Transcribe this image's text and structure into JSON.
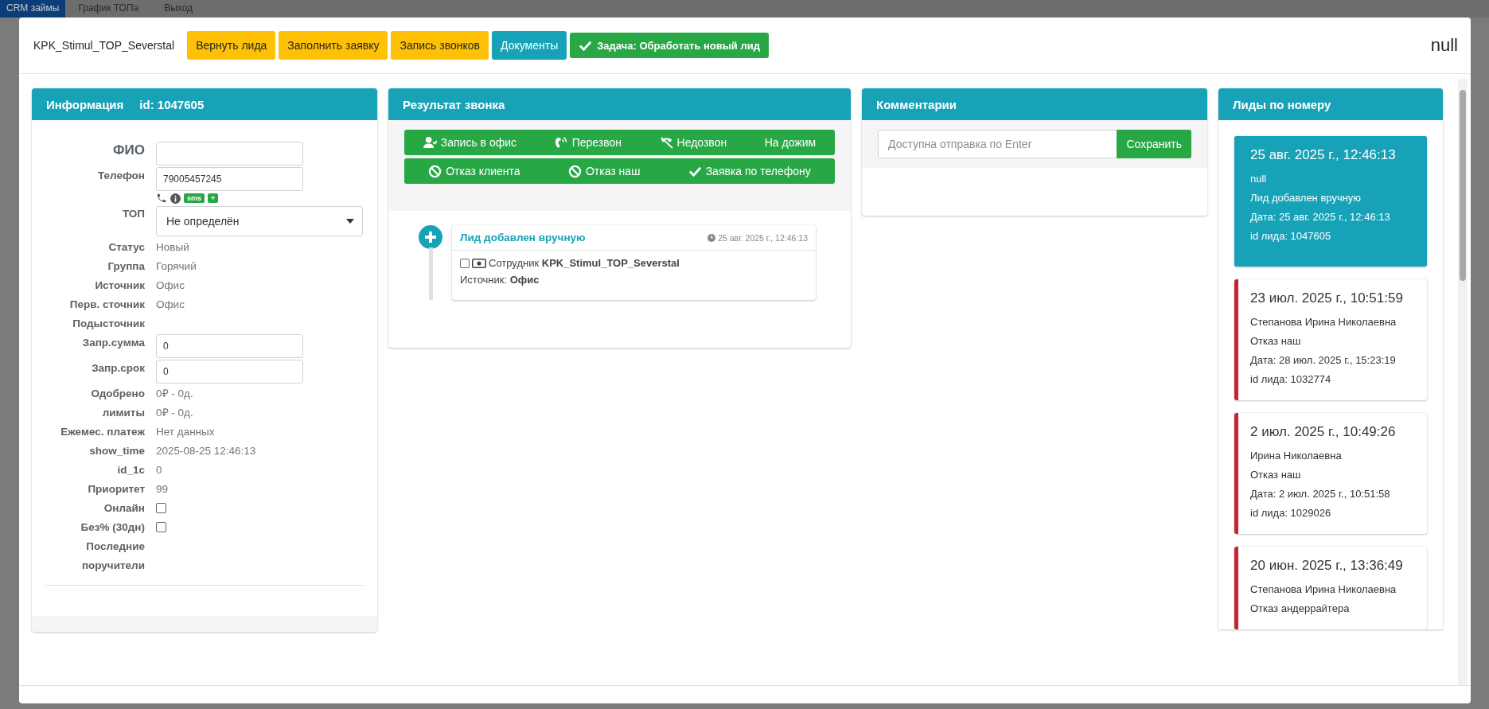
{
  "background_nav": {
    "brand": "CRM займы",
    "links": [
      "График ТОПа",
      "Выход"
    ]
  },
  "modal": {
    "title": "KPK_Stimul_TOP_Severstal",
    "right_text": "null",
    "buttons": [
      {
        "label": "Вернуть лида",
        "kind": "warning"
      },
      {
        "label": "Заполнить заявку",
        "kind": "warning"
      },
      {
        "label": "Запись звонков",
        "kind": "warning"
      },
      {
        "label": "Документы",
        "kind": "info"
      },
      {
        "label": "Задача: Обработать новый лид",
        "kind": "success"
      }
    ]
  },
  "info_panel": {
    "title": "Информация",
    "id": "id: 1047605",
    "fields": [
      {
        "label": "ФИО",
        "kind": "input"
      },
      {
        "label": "Телефон",
        "kind": "phone",
        "value": "79005457245",
        "badges": [
          "sms",
          "+"
        ]
      },
      {
        "label": "ТОП",
        "kind": "select",
        "value": "Не определён"
      },
      {
        "label": "Статус",
        "kind": "text",
        "value": "Новый"
      },
      {
        "label": "Группа",
        "kind": "text",
        "value": "Горячий"
      },
      {
        "label": "Источник",
        "kind": "text",
        "value": "Офис"
      },
      {
        "label": "Перв. сточник",
        "kind": "text",
        "value": "Офис"
      },
      {
        "label": "Подысточник",
        "kind": "text"
      },
      {
        "label": "Запр.сумма",
        "kind": "input",
        "value": "0"
      },
      {
        "label": "Запр.срок",
        "kind": "input",
        "value": "0"
      },
      {
        "label": "Одобрено",
        "kind": "text",
        "value": "0₽ - 0д."
      },
      {
        "label": "лимиты",
        "kind": "text",
        "value": "0₽ - 0д."
      },
      {
        "label": "Ежемес. платеж",
        "kind": "text",
        "value": "Нет данных"
      },
      {
        "label": "show_time",
        "kind": "text",
        "value": "2025-08-25 12:46:13"
      },
      {
        "label": "id_1c",
        "kind": "text",
        "value": "0"
      },
      {
        "label": "Приоритет",
        "kind": "text",
        "value": "99"
      },
      {
        "label": "Онлайн",
        "kind": "checkbox",
        "checked": false
      },
      {
        "label": "Без% (30дн)",
        "kind": "checkbox",
        "checked": false
      },
      {
        "label": "Последние поручители",
        "kind": "text"
      }
    ]
  },
  "result_panel": {
    "title": "Результат звонка",
    "button_rows": [
      [
        {
          "label": "Запись в офис"
        },
        {
          "label": "Перезвон"
        },
        {
          "label": "Недозвон"
        },
        {
          "label": "На дожим"
        }
      ],
      [
        {
          "label": "Отказ клиента"
        },
        {
          "label": "Отказ наш"
        },
        {
          "label": "Заявка по телефону"
        }
      ]
    ],
    "timeline": [
      {
        "title": "Лид добавлен вручную",
        "time": "25 авг. 2025 г., 12:46:13",
        "checked": false,
        "employee": "Сотрудник **KPK_Stimul_TOP_Severstal**",
        "source": "Источник: **Офис**"
      }
    ]
  },
  "comments_panel": {
    "title": "Комментарии",
    "placeholder": "Доступна отправка по Enter",
    "button": "Сохранить"
  },
  "leads_panel": {
    "title": "Лиды по номеру",
    "items": [
      {
        "selected": true,
        "date": "25 авг. 2025 г., 12:46:13",
        "lines": [
          "null",
          "Лид добавлен вручную",
          "Дата: 25 авг. 2025 г., 12:46:13",
          "id лида: 1047605"
        ]
      },
      {
        "selected": false,
        "date": "23 июл. 2025 г., 10:51:59",
        "lines": [
          "Степанова Ирина Николаевна",
          "Отказ наш",
          "Дата: 28 июл. 2025 г., 15:23:19",
          "id лида: 1032774"
        ]
      },
      {
        "selected": false,
        "date": "2 июл. 2025 г., 10:49:26",
        "lines": [
          "Ирина Николаевна",
          "Отказ наш",
          "Дата: 2 июл. 2025 г., 10:51:58",
          "id лида: 1029026"
        ]
      },
      {
        "selected": false,
        "date": "20 июн. 2025 г., 13:36:49",
        "lines": [
          "Степанова Ирина Николаевна",
          "Отказ андеррайтера"
        ]
      }
    ]
  }
}
